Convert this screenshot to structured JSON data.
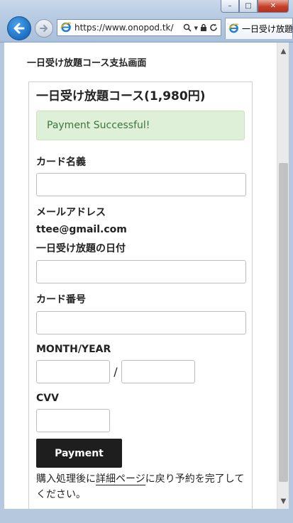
{
  "browser": {
    "url": "https://www.onopod.tk/",
    "tab_title": "一日受け放題",
    "window_buttons": {
      "minimize": "–",
      "maximize": "□",
      "close": "✕"
    }
  },
  "page": {
    "title": "一日受け放題コース支払画面",
    "plan_title": "一日受け放題コース(1,980円)",
    "alert": "Payment Successful!",
    "card_name_label": "カード名義",
    "email_label": "メールアドレス",
    "email_value": "ttee@gmail.com",
    "date_label": "一日受け放題の日付",
    "card_number_label": "カード番号",
    "month_year_label": "MONTH/YEAR",
    "slash": "/",
    "cvv_label": "CVV",
    "payment_button": "Payment",
    "note_prefix": "購入処理後に",
    "note_link": "詳細ページ",
    "note_suffix": "に戻り予約を完了してください。"
  }
}
